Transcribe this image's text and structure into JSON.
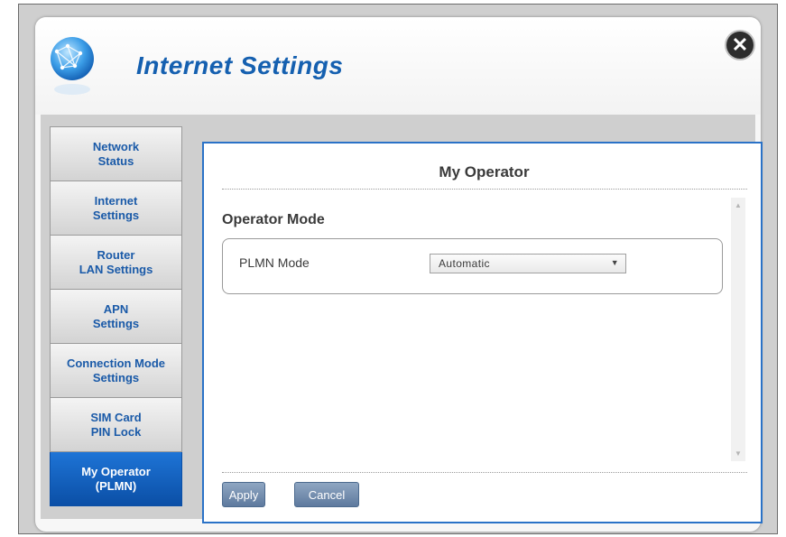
{
  "header": {
    "title": "Internet Settings",
    "close_icon": "close-x-icon",
    "logo_icon": "globe-network-icon"
  },
  "sidebar": {
    "items": [
      {
        "label": "Network\nStatus",
        "active": false
      },
      {
        "label": "Internet\nSettings",
        "active": false
      },
      {
        "label": "Router\nLAN Settings",
        "active": false
      },
      {
        "label": "APN\nSettings",
        "active": false
      },
      {
        "label": "Connection Mode\nSettings",
        "active": false
      },
      {
        "label": "SIM Card\nPIN Lock",
        "active": false
      },
      {
        "label": "My Operator\n(PLMN)",
        "active": true
      }
    ]
  },
  "main": {
    "title": "My Operator",
    "section_title": "Operator Mode",
    "plmn_label": "PLMN Mode",
    "plmn_value": "Automatic",
    "apply_label": "Apply",
    "cancel_label": "Cancel"
  },
  "colors": {
    "accent": "#1560b0",
    "active_nav": "#0b4fa6",
    "panel_border": "#2a72c7",
    "button": "#6d87aa"
  }
}
